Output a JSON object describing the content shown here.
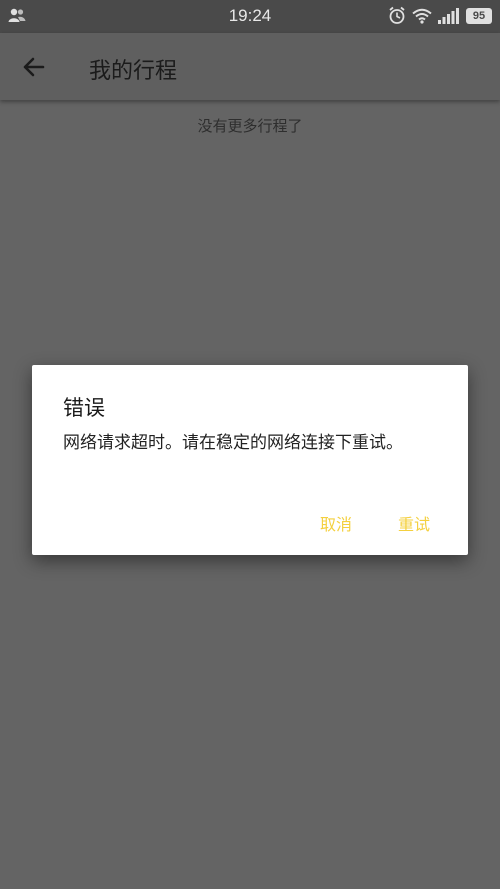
{
  "status_bar": {
    "time": "19:24",
    "battery": "95",
    "icons": [
      "user-icon",
      "alarm-icon",
      "wifi-icon",
      "signal-icon",
      "battery-icon"
    ]
  },
  "app_bar": {
    "back_icon": "back-arrow-icon",
    "title": "我的行程"
  },
  "main": {
    "empty_text": "没有更多行程了"
  },
  "dialog": {
    "title": "错误",
    "message": "网络请求超时。请在稳定的网络连接下重试。",
    "cancel_label": "取消",
    "retry_label": "重试"
  },
  "colors": {
    "accent": "#f4d03f",
    "overlay_background": "#646464",
    "dialog_background": "#ffffff"
  }
}
